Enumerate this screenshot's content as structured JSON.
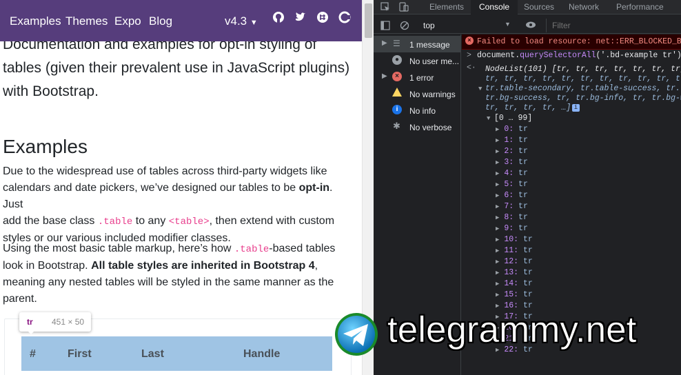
{
  "navbar": {
    "links": [
      "Examples",
      "Themes",
      "Expo",
      "Blog"
    ],
    "version": "v4.3",
    "icons": [
      "github-icon",
      "twitter-icon",
      "slack-icon",
      "opencollective-icon"
    ]
  },
  "lead": {
    "line1": "Documentation and examples for opt-in styling of",
    "line2": "tables (given their prevalent use in JavaScript plugins)",
    "line3": "with Bootstrap."
  },
  "examples": {
    "heading": "Examples",
    "p1": {
      "l1": "Due to the widespread use of tables across third-party widgets like",
      "l2a": "calendars and date pickers, we’ve designed our tables to be ",
      "l2b": "opt-in",
      "l2c": ". Just",
      "l3a": "add the base class ",
      "l3code1": ".table",
      "l3b": " to any ",
      "l3code2": "<table>",
      "l3c": ", then extend with custom",
      "l4": "styles or our various included modifier classes."
    },
    "p2": {
      "l1a": "Using the most basic table markup, here’s how ",
      "l1code": ".table",
      "l1b": "-based tables",
      "l2a": "look in Bootstrap. ",
      "l2b": "All table styles are inherited in Bootstrap 4",
      "l2c": ",",
      "l3": "meaning any nested tables will be styled in the same manner as the",
      "l4": "parent."
    }
  },
  "tooltip": {
    "tag": "tr",
    "size": "451 × 50"
  },
  "table_header": [
    "#",
    "First",
    "Last",
    "Handle"
  ],
  "devtools": {
    "tabs": [
      "Elements",
      "Console",
      "Sources",
      "Network",
      "Performance"
    ],
    "active_tab": "Console",
    "context": "top",
    "filter_placeholder": "Filter",
    "sidebar": [
      {
        "label": "1 message",
        "icon": "list-icon"
      },
      {
        "label": "No user me...",
        "icon": "user-icon"
      },
      {
        "label": "1 error",
        "icon": "error-icon"
      },
      {
        "label": "No warnings",
        "icon": "warning-icon"
      },
      {
        "label": "No info",
        "icon": "info-icon"
      },
      {
        "label": "No verbose",
        "icon": "bug-icon"
      }
    ],
    "console": {
      "error": "Failed to load resource: net::ERR_BLOCKED_BY_",
      "command_pre": "document.",
      "command_fn": "querySelectorAll",
      "command_arg": "('.bd-example tr')",
      "nodelist_head": "NodeList(101) [tr, tr, tr, tr, tr, tr, tr,",
      "nodelist_l2": "tr, tr, tr, tr, tr, tr, tr, tr, tr, tr, tr,",
      "nodelist_l3": "tr.table-secondary, tr.table-success, tr.ta",
      "nodelist_l4": "tr.bg-success, tr, tr.bg-info, tr, tr.bg-wa",
      "nodelist_l5": "tr, tr, tr, tr, …]",
      "range": "[0 … 99]",
      "items": [
        "0",
        "1",
        "2",
        "3",
        "4",
        "5",
        "6",
        "7",
        "8",
        "9",
        "10",
        "11",
        "12",
        "13",
        "14",
        "15",
        "16",
        "17",
        "20",
        "21",
        "22"
      ],
      "item_value": "tr"
    }
  },
  "watermark": {
    "text": "telegrammy.net"
  }
}
